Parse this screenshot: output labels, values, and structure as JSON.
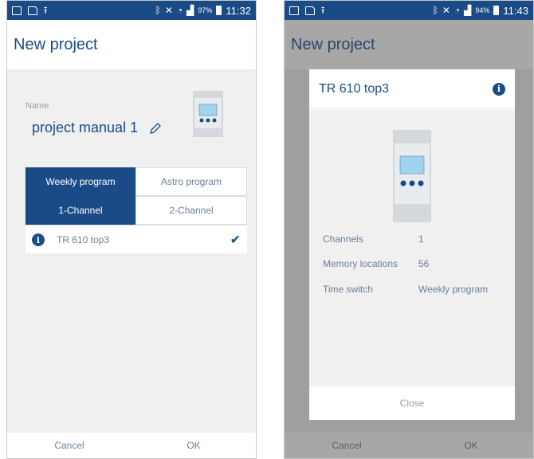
{
  "left": {
    "status": {
      "percent": "97%",
      "time": "11:32"
    },
    "title": "New project",
    "name_label": "Name",
    "name_value": "project manual 1",
    "program_tabs": [
      {
        "label": "Weekly program",
        "active": true
      },
      {
        "label": "Astro program",
        "active": false
      }
    ],
    "channel_tabs": [
      {
        "label": "1-Channel",
        "active": true
      },
      {
        "label": "2-Channel",
        "active": false
      }
    ],
    "device": {
      "name": "TR 610 top3",
      "selected": true
    },
    "buttons": {
      "cancel": "Cancel",
      "ok": "OK"
    }
  },
  "right": {
    "status": {
      "percent": "94%",
      "time": "11:43"
    },
    "title": "New project",
    "dialog": {
      "title": "TR 610 top3",
      "properties": [
        {
          "key": "Channels",
          "value": "1"
        },
        {
          "key": "Memory locations",
          "value": "56"
        },
        {
          "key": "Time switch",
          "value": "Weekly program"
        }
      ],
      "close_label": "Close"
    },
    "buttons": {
      "cancel": "Cancel",
      "ok": "OK"
    }
  },
  "colors": {
    "accent": "#1a4b86",
    "background": "#f0f0f0",
    "muted_text": "#6b7f99"
  },
  "icons": [
    "gallery-icon",
    "document-icon",
    "upload-icon",
    "bluetooth-icon",
    "mute-icon",
    "wifi-icon",
    "signal-icon",
    "battery-icon",
    "pencil-icon",
    "info-icon",
    "check-icon"
  ]
}
